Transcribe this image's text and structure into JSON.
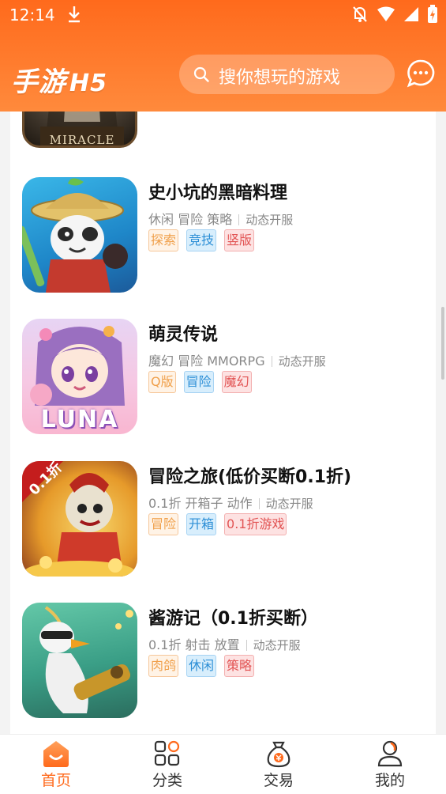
{
  "status": {
    "time": "12:14"
  },
  "header": {
    "logo_main": "手游",
    "logo_sub": "H5",
    "search_placeholder": "搜你想玩的游戏",
    "message_icon": "chat-bubble-icon"
  },
  "partial_item": {
    "thumb_text": "MIRACLE"
  },
  "games": [
    {
      "title": "史小坑的黑暗料理",
      "meta": [
        "休闲",
        "冒险",
        "策略"
      ],
      "open": "动态开服",
      "tags": [
        "探索",
        "竞技",
        "竖版"
      ]
    },
    {
      "title": "萌灵传说",
      "meta": [
        "魔幻",
        "冒险",
        "MMORPG"
      ],
      "open": "动态开服",
      "tags": [
        "Q版",
        "冒险",
        "魔幻"
      ],
      "thumb_text": "LUNA"
    },
    {
      "title": "冒险之旅(低价买断0.1折)",
      "meta": [
        "0.1折",
        "开箱子",
        "动作"
      ],
      "open": "动态开服",
      "tags": [
        "冒险",
        "开箱",
        "0.1折游戏"
      ],
      "thumb_badge": "0.1折"
    },
    {
      "title": "酱游记（0.1折买断）",
      "meta": [
        "0.1折",
        "射击",
        "放置"
      ],
      "open": "动态开服",
      "tags": [
        "肉鸽",
        "休闲",
        "策略"
      ]
    }
  ],
  "bottom_nav": [
    {
      "label": "首页",
      "icon": "home-icon",
      "active": true
    },
    {
      "label": "分类",
      "icon": "category-grid-icon",
      "active": false
    },
    {
      "label": "交易",
      "icon": "money-bag-icon",
      "active": false
    },
    {
      "label": "我的",
      "icon": "user-icon",
      "active": false
    }
  ],
  "colors": {
    "accent": "#ff6a1c",
    "tag_orange": "#f0a04b",
    "tag_blue": "#2d8fd6",
    "tag_red": "#e25555"
  }
}
